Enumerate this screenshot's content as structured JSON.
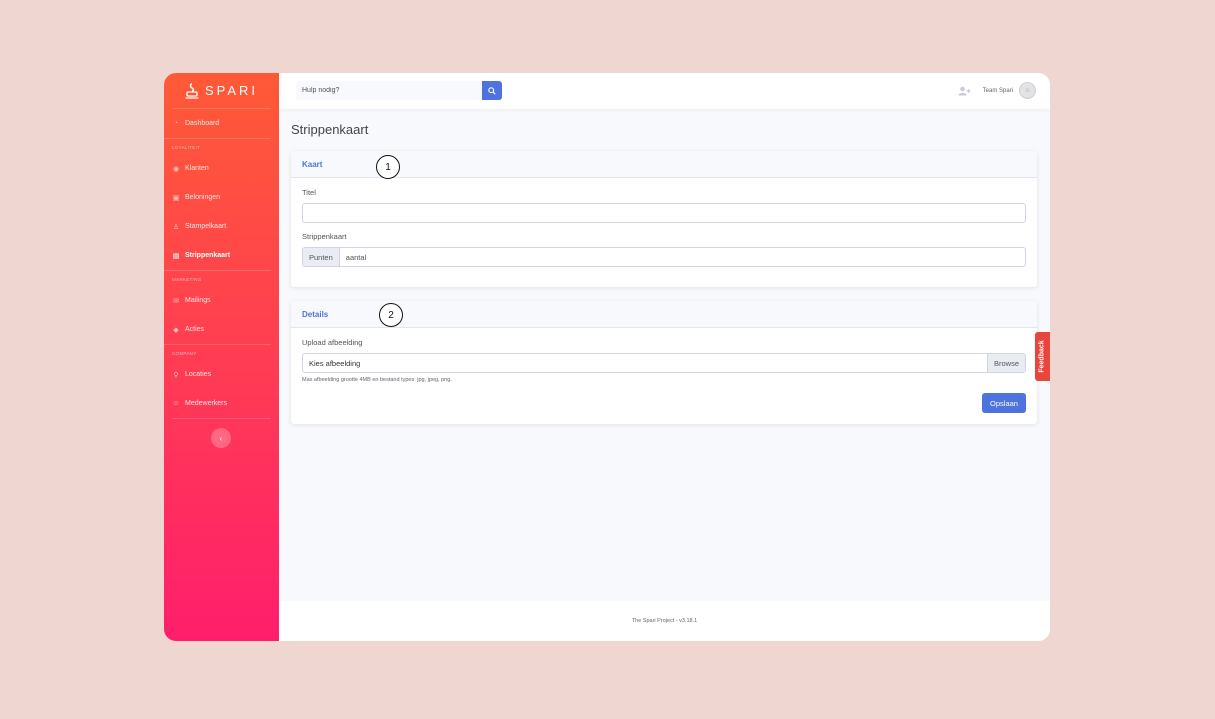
{
  "brand": {
    "name": "SPARI"
  },
  "sidebar": {
    "items": [
      {
        "label": "Dashboard",
        "icon": "dashboard-icon"
      },
      {
        "heading": "LOYALITEIT"
      },
      {
        "label": "Klanten",
        "icon": "eye-icon"
      },
      {
        "label": "Beloningen",
        "icon": "gift-icon"
      },
      {
        "label": "Stampelkaart",
        "icon": "stamp-icon"
      },
      {
        "label": "Strippenkaart",
        "icon": "clipboard-icon",
        "active": true
      },
      {
        "heading": "MARKETING"
      },
      {
        "label": "Mailings",
        "icon": "mail-icon"
      },
      {
        "label": "Acties",
        "icon": "tag-icon"
      },
      {
        "heading": "COMPANY"
      },
      {
        "label": "Locaties",
        "icon": "location-icon"
      },
      {
        "label": "Medewerkers",
        "icon": "users-icon"
      }
    ],
    "toggle": "‹"
  },
  "topbar": {
    "search_placeholder": "Hulp nodig?",
    "user_name": "Team Spari"
  },
  "page": {
    "title": "Strippenkaart"
  },
  "card_kaart": {
    "header": "Kaart",
    "marker": "1",
    "titel_label": "Titel",
    "titel_value": "",
    "strippenkaart_label": "Strippenkaart",
    "addon": "Punten",
    "aantal": "aantal"
  },
  "card_details": {
    "header": "Details",
    "marker": "2",
    "upload_label": "Upload afbeelding",
    "file_text": "Kies afbeelding",
    "browse": "Browse",
    "hint": "Max afbeelding grootte 4MB en bestand types: jpg, jpeg, png.",
    "save": "Opslaan"
  },
  "feedback": "Feedback",
  "footer": "The Spari Project - v3.18.1",
  "colors": {
    "accent": "#4e73df",
    "sidebar_top": "#ff5a36",
    "sidebar_bottom": "#ff1e6c",
    "feedback": "#e8453c"
  }
}
